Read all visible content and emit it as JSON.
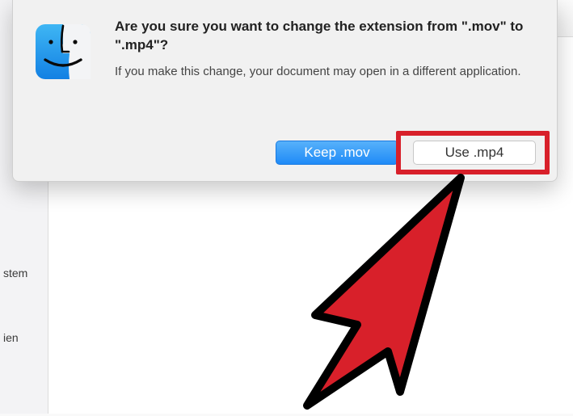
{
  "dialog": {
    "title": "Are you sure you want to change the extension from \".mov\" to \".mp4\"?",
    "message": "If you make this change, your document may open in a different application.",
    "keep_label": "Keep .mov",
    "use_label": "Use .mp4"
  },
  "sidebar": {
    "items": [
      {
        "label": ""
      },
      {
        "label": ""
      },
      {
        "label": "stem"
      },
      {
        "label": ""
      },
      {
        "label": "ien"
      }
    ]
  },
  "colors": {
    "primary_button": "#1f8bf7",
    "highlight": "#d8202a"
  }
}
